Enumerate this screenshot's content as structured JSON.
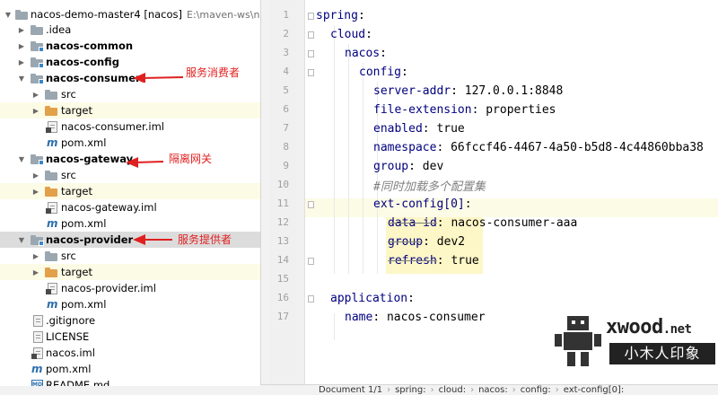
{
  "tree": {
    "root": {
      "label": "nacos-demo-master4 [nacos]",
      "path": "E:\\maven-ws\\naco"
    },
    "items": [
      {
        "label": ".idea"
      },
      {
        "label": "nacos-common"
      },
      {
        "label": "nacos-config"
      },
      {
        "label": "nacos-consumer"
      },
      {
        "label": "src"
      },
      {
        "label": "target"
      },
      {
        "label": "nacos-consumer.iml"
      },
      {
        "label": "pom.xml"
      },
      {
        "label": "nacos-gateway"
      },
      {
        "label": "src"
      },
      {
        "label": "target"
      },
      {
        "label": "nacos-gateway.iml"
      },
      {
        "label": "pom.xml"
      },
      {
        "label": "nacos-provider"
      },
      {
        "label": "src"
      },
      {
        "label": "target"
      },
      {
        "label": "nacos-provider.iml"
      },
      {
        "label": "pom.xml"
      },
      {
        "label": ".gitignore"
      },
      {
        "label": "LICENSE"
      },
      {
        "label": "nacos.iml"
      },
      {
        "label": "pom.xml"
      },
      {
        "label": "README.md"
      }
    ],
    "annotations": {
      "consumer": "服务消费者",
      "gateway": "隔离网关",
      "provider": "服务提供者"
    }
  },
  "editor": {
    "line_numbers": [
      "1",
      "2",
      "3",
      "4",
      "5",
      "6",
      "7",
      "8",
      "9",
      "10",
      "11",
      "12",
      "13",
      "14",
      "15",
      "16",
      "17"
    ],
    "lines": {
      "l1_key": "spring",
      "l2_key": "cloud",
      "l3_key": "nacos",
      "l4_key": "config",
      "l5_key": "server-addr",
      "l5_val": "127.0.0.1:8848",
      "l6_key": "file-extension",
      "l6_val": "properties",
      "l7_key": "enabled",
      "l7_val": "true",
      "l8_key": "namespace",
      "l8_val": "66fccf46-4467-4a50-b5d8-4c44860bba38",
      "l9_key": "group",
      "l9_val": "dev",
      "l10_comment": "#同时加载多个配置集",
      "l11_key": "ext-config[0]",
      "l12_key": "data-id",
      "l12_val": "nacos-consumer-aaa",
      "l13_key": "group",
      "l13_val": "dev2",
      "l14_key": "refresh",
      "l14_val": "true",
      "l16_key": "application",
      "l17_key": "name",
      "l17_val": "nacos-consumer"
    }
  },
  "breadcrumb": {
    "doc": "Document 1/1",
    "items": [
      "spring:",
      "cloud:",
      "nacos:",
      "config:",
      "ext-config[0]:"
    ]
  },
  "watermark": {
    "brand": "xwood",
    "brand_suffix": ".net",
    "cn": "小木人印象"
  },
  "colors": {
    "key": "#000080",
    "comment": "#808080",
    "annotation": "#e02020",
    "highlight_line": "#fcfbe6",
    "selected_row": "#dcdcdc"
  }
}
